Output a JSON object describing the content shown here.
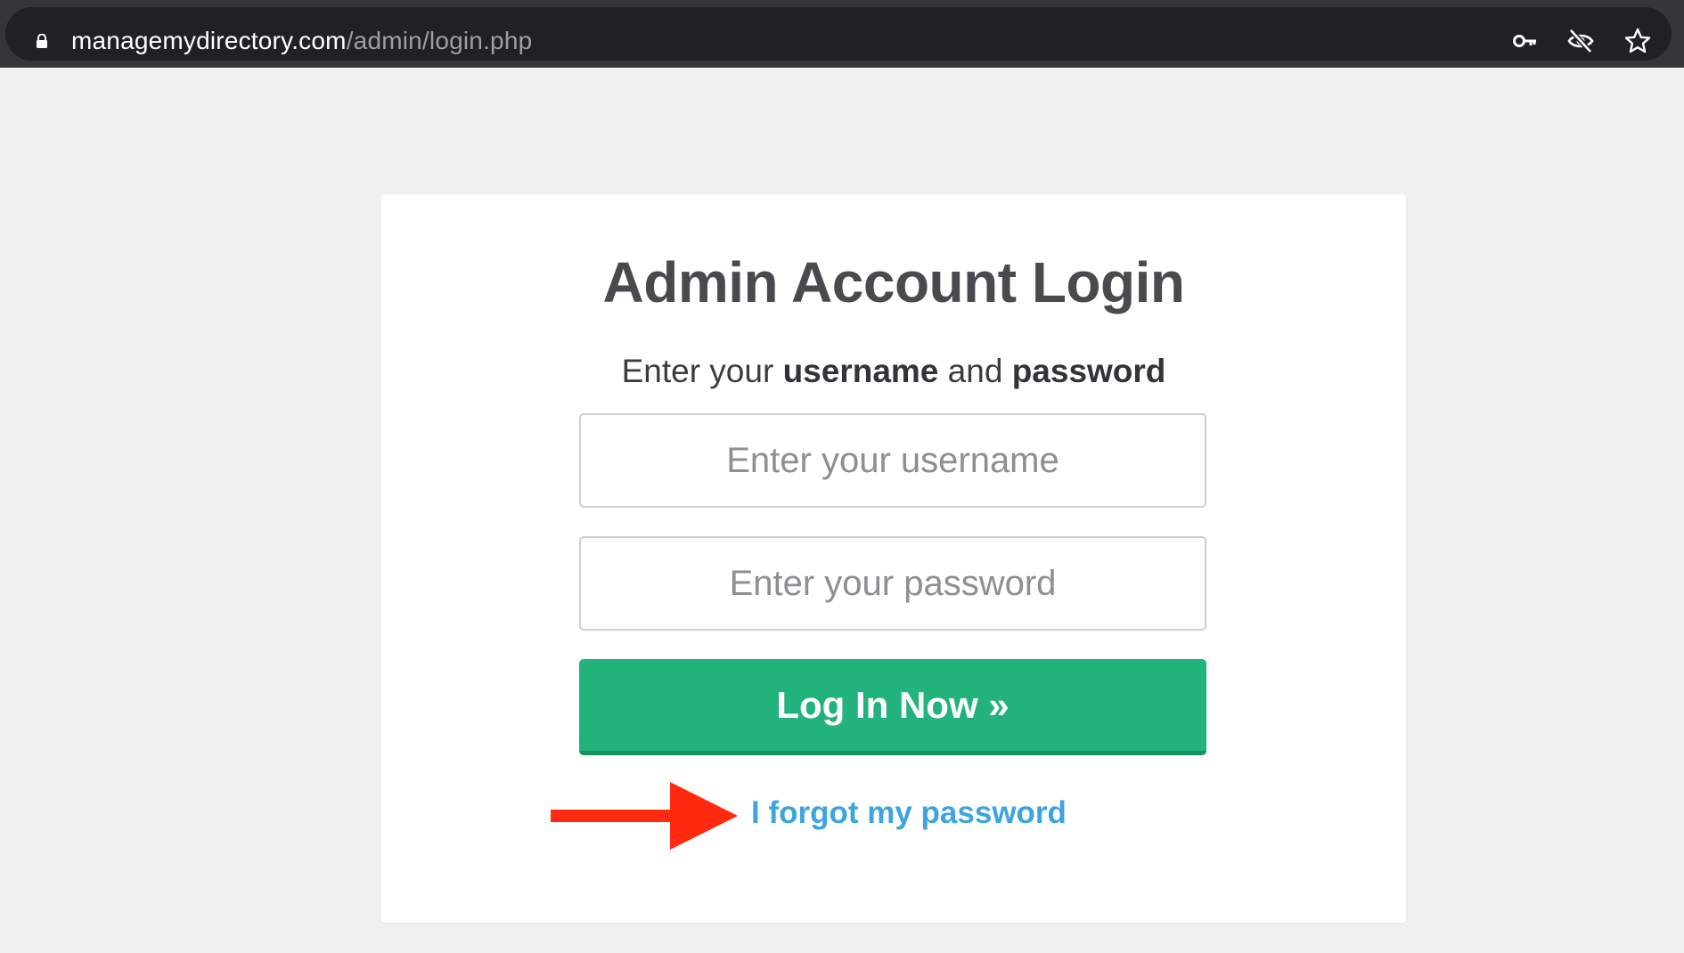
{
  "browser": {
    "url_host": "managemydirectory.com",
    "url_path": "/admin/login.php",
    "icons": [
      "lock-icon",
      "key-icon",
      "eye-off-icon",
      "star-icon"
    ]
  },
  "login": {
    "title": "Admin Account Login",
    "subtitle_prefix": "Enter your ",
    "subtitle_username": "username",
    "subtitle_and": " and ",
    "subtitle_password": "password",
    "username_placeholder": "Enter your username",
    "password_placeholder": "Enter your password",
    "submit_label": "Log In Now »",
    "forgot_label": "I forgot my password"
  },
  "annotation": {
    "arrow_color": "#ff2a10"
  },
  "colors": {
    "button": "#22b27c",
    "link": "#3ea4e0"
  }
}
